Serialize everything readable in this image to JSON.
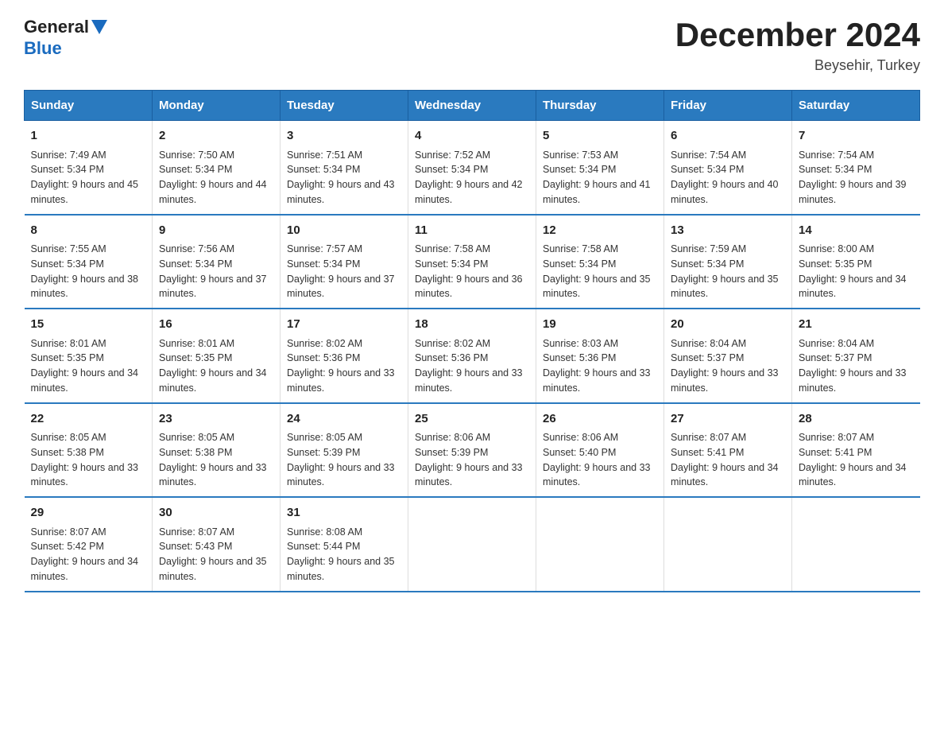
{
  "header": {
    "logo_general": "General",
    "logo_blue": "Blue",
    "month_title": "December 2024",
    "location": "Beysehir, Turkey"
  },
  "days_of_week": [
    "Sunday",
    "Monday",
    "Tuesday",
    "Wednesday",
    "Thursday",
    "Friday",
    "Saturday"
  ],
  "weeks": [
    [
      {
        "day": "1",
        "sunrise": "7:49 AM",
        "sunset": "5:34 PM",
        "daylight": "9 hours and 45 minutes."
      },
      {
        "day": "2",
        "sunrise": "7:50 AM",
        "sunset": "5:34 PM",
        "daylight": "9 hours and 44 minutes."
      },
      {
        "day": "3",
        "sunrise": "7:51 AM",
        "sunset": "5:34 PM",
        "daylight": "9 hours and 43 minutes."
      },
      {
        "day": "4",
        "sunrise": "7:52 AM",
        "sunset": "5:34 PM",
        "daylight": "9 hours and 42 minutes."
      },
      {
        "day": "5",
        "sunrise": "7:53 AM",
        "sunset": "5:34 PM",
        "daylight": "9 hours and 41 minutes."
      },
      {
        "day": "6",
        "sunrise": "7:54 AM",
        "sunset": "5:34 PM",
        "daylight": "9 hours and 40 minutes."
      },
      {
        "day": "7",
        "sunrise": "7:54 AM",
        "sunset": "5:34 PM",
        "daylight": "9 hours and 39 minutes."
      }
    ],
    [
      {
        "day": "8",
        "sunrise": "7:55 AM",
        "sunset": "5:34 PM",
        "daylight": "9 hours and 38 minutes."
      },
      {
        "day": "9",
        "sunrise": "7:56 AM",
        "sunset": "5:34 PM",
        "daylight": "9 hours and 37 minutes."
      },
      {
        "day": "10",
        "sunrise": "7:57 AM",
        "sunset": "5:34 PM",
        "daylight": "9 hours and 37 minutes."
      },
      {
        "day": "11",
        "sunrise": "7:58 AM",
        "sunset": "5:34 PM",
        "daylight": "9 hours and 36 minutes."
      },
      {
        "day": "12",
        "sunrise": "7:58 AM",
        "sunset": "5:34 PM",
        "daylight": "9 hours and 35 minutes."
      },
      {
        "day": "13",
        "sunrise": "7:59 AM",
        "sunset": "5:34 PM",
        "daylight": "9 hours and 35 minutes."
      },
      {
        "day": "14",
        "sunrise": "8:00 AM",
        "sunset": "5:35 PM",
        "daylight": "9 hours and 34 minutes."
      }
    ],
    [
      {
        "day": "15",
        "sunrise": "8:01 AM",
        "sunset": "5:35 PM",
        "daylight": "9 hours and 34 minutes."
      },
      {
        "day": "16",
        "sunrise": "8:01 AM",
        "sunset": "5:35 PM",
        "daylight": "9 hours and 34 minutes."
      },
      {
        "day": "17",
        "sunrise": "8:02 AM",
        "sunset": "5:36 PM",
        "daylight": "9 hours and 33 minutes."
      },
      {
        "day": "18",
        "sunrise": "8:02 AM",
        "sunset": "5:36 PM",
        "daylight": "9 hours and 33 minutes."
      },
      {
        "day": "19",
        "sunrise": "8:03 AM",
        "sunset": "5:36 PM",
        "daylight": "9 hours and 33 minutes."
      },
      {
        "day": "20",
        "sunrise": "8:04 AM",
        "sunset": "5:37 PM",
        "daylight": "9 hours and 33 minutes."
      },
      {
        "day": "21",
        "sunrise": "8:04 AM",
        "sunset": "5:37 PM",
        "daylight": "9 hours and 33 minutes."
      }
    ],
    [
      {
        "day": "22",
        "sunrise": "8:05 AM",
        "sunset": "5:38 PM",
        "daylight": "9 hours and 33 minutes."
      },
      {
        "day": "23",
        "sunrise": "8:05 AM",
        "sunset": "5:38 PM",
        "daylight": "9 hours and 33 minutes."
      },
      {
        "day": "24",
        "sunrise": "8:05 AM",
        "sunset": "5:39 PM",
        "daylight": "9 hours and 33 minutes."
      },
      {
        "day": "25",
        "sunrise": "8:06 AM",
        "sunset": "5:39 PM",
        "daylight": "9 hours and 33 minutes."
      },
      {
        "day": "26",
        "sunrise": "8:06 AM",
        "sunset": "5:40 PM",
        "daylight": "9 hours and 33 minutes."
      },
      {
        "day": "27",
        "sunrise": "8:07 AM",
        "sunset": "5:41 PM",
        "daylight": "9 hours and 34 minutes."
      },
      {
        "day": "28",
        "sunrise": "8:07 AM",
        "sunset": "5:41 PM",
        "daylight": "9 hours and 34 minutes."
      }
    ],
    [
      {
        "day": "29",
        "sunrise": "8:07 AM",
        "sunset": "5:42 PM",
        "daylight": "9 hours and 34 minutes."
      },
      {
        "day": "30",
        "sunrise": "8:07 AM",
        "sunset": "5:43 PM",
        "daylight": "9 hours and 35 minutes."
      },
      {
        "day": "31",
        "sunrise": "8:08 AM",
        "sunset": "5:44 PM",
        "daylight": "9 hours and 35 minutes."
      },
      null,
      null,
      null,
      null
    ]
  ],
  "labels": {
    "sunrise": "Sunrise:",
    "sunset": "Sunset:",
    "daylight": "Daylight:"
  }
}
